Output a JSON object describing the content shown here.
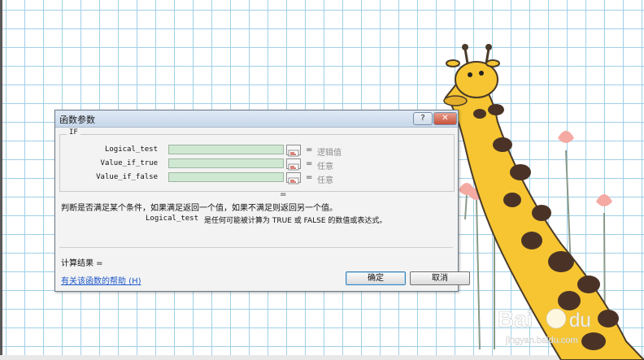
{
  "dialog": {
    "title": "函数参数",
    "help_button": "?",
    "close_button": "✕",
    "function_name": "IF",
    "arguments": [
      {
        "label": "Logical_test",
        "value": "逻辑值"
      },
      {
        "label": "Value_if_true",
        "value": "任意"
      },
      {
        "label": "Value_if_false",
        "value": "任意"
      }
    ],
    "equals": "=",
    "summary_equals": "=",
    "description": "判断是否满足某个条件，如果满足返回一个值，如果不满足则返回另一个值。",
    "param_name": "Logical_test",
    "param_description": "是任何可能被计算为 TRUE 或 FALSE 的数值或表达式。",
    "result_label": "计算结果 =",
    "help_link": "有关该函数的帮助 (H)",
    "ok_button": "确定",
    "cancel_button": "取消"
  },
  "colors": {
    "input_fill": "#cfe8d2",
    "arrow": "#e53935",
    "link": "#1c56c9",
    "grid": "#9fd0e6"
  },
  "icons": [
    "red-arrow-icon",
    "collapse-dialog-icon",
    "giraffe-illustration",
    "baidu-watermark"
  ]
}
